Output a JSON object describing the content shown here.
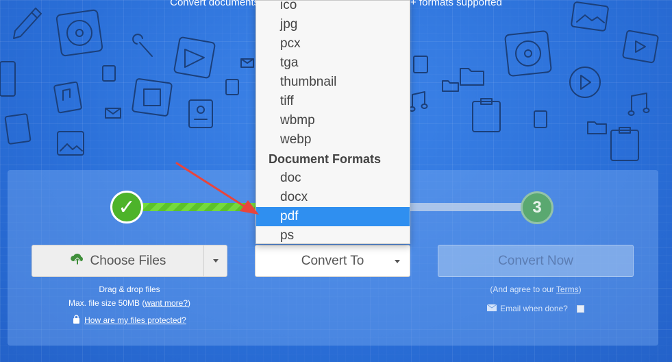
{
  "header": {
    "tagline": "Convert documents,                                                    + formats supported"
  },
  "steps": {
    "step1_mark": "✓",
    "step3_number": "3"
  },
  "choose_files": {
    "label": "Choose Files"
  },
  "convert_to": {
    "label": "Convert To",
    "options": [
      {
        "type": "item",
        "label": "ico"
      },
      {
        "type": "item",
        "label": "jpg"
      },
      {
        "type": "item",
        "label": "pcx"
      },
      {
        "type": "item",
        "label": "tga"
      },
      {
        "type": "item",
        "label": "thumbnail"
      },
      {
        "type": "item",
        "label": "tiff"
      },
      {
        "type": "item",
        "label": "wbmp"
      },
      {
        "type": "item",
        "label": "webp"
      },
      {
        "type": "group",
        "label": "Document Formats"
      },
      {
        "type": "item",
        "label": "doc"
      },
      {
        "type": "item",
        "label": "docx"
      },
      {
        "type": "item",
        "label": "pdf",
        "selected": true
      },
      {
        "type": "item",
        "label": "ps"
      }
    ]
  },
  "convert_now": {
    "label": "Convert Now"
  },
  "upload_info": {
    "drag_drop": "Drag & drop files",
    "max_size_prefix": "Max. file size 50MB (",
    "want_more": "want more?",
    "max_size_suffix": ")",
    "protected_link": "How are my files protected?"
  },
  "convert_info": {
    "agree_prefix": "(And agree to our ",
    "terms": "Terms",
    "agree_suffix": ")",
    "email_label": "Email when done?"
  },
  "colors": {
    "background": "#2a6fd8",
    "progress_done": "#4db32a",
    "selected_option": "#2f8ff0",
    "annotation_arrow": "#e8453c"
  }
}
